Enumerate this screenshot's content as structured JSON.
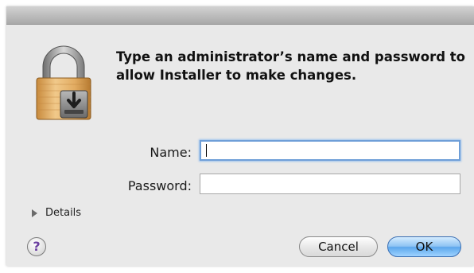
{
  "dialog": {
    "message": "Type an administrator’s name and password to allow Installer to make changes.",
    "icon": "lock-installer-icon"
  },
  "form": {
    "name_label": "Name:",
    "name_value": "",
    "password_label": "Password:",
    "password_value": ""
  },
  "details": {
    "label": "Details",
    "expanded": false
  },
  "buttons": {
    "help_label": "?",
    "cancel_label": "Cancel",
    "ok_label": "OK"
  },
  "colors": {
    "window_bg": "#e9e9e9",
    "focus_ring": "#6f9fd8",
    "default_button": "#5ba6ec"
  }
}
